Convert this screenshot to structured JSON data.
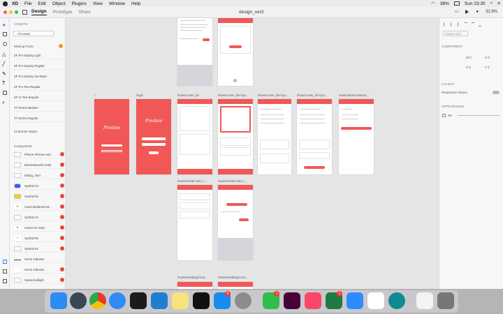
{
  "menubar": {
    "items": [
      "XD",
      "File",
      "Edit",
      "Object",
      "Plugins",
      "View",
      "Window",
      "Help"
    ],
    "battery": "38%",
    "clock": "Sun 23:30"
  },
  "titlebar": {
    "tabs": [
      "Design",
      "Prototype",
      "Share"
    ],
    "doc_title": "design_ver3",
    "zoom": "32.9%"
  },
  "assets": {
    "heading": "ASSETS",
    "filter": "All Assets",
    "missing_fonts_label": "Missing Fonts",
    "fonts": [
      "SF Pro Display Light",
      "SF Pro Display Regular",
      "SF Pro Display Semibold",
      "SF Pro Text Regular",
      "SF UI Text Regular",
      "TT Norms Medium",
      "TT Norms Regular"
    ],
    "character_styles_label": "Character Styles",
    "components_label": "Components",
    "components": [
      "iPhone X/Home Indi...",
      "Bars/Status/On Dark",
      "Dialog_Alert",
      "Symbol 44",
      "Symbol 93",
      "round-airplanemod...",
      "Symbol 44",
      "round-mic-24px",
      "Symbol 60",
      "Symbol 61",
      "Home Indicator",
      "Home Indicator",
      "Status bar/light"
    ]
  },
  "artboards": {
    "labels": [
      "/",
      "/login",
      "/home/<user_id>",
      "/home/<user_id>/<po...",
      "/home/<user_id>/<po...",
      "/home/<user_id>/<po...",
      "/reservation/<reserva...",
      "/mentor/chat/<user_i...",
      "/mentor/chat/<user_i...",
      "/mentor/settings/<me...",
      "/mentor/settings/<me..."
    ],
    "brand": "Presbee"
  },
  "property_inspector": {
    "repeat_grid": "Repeat Grid",
    "component_label": "COMPONENT",
    "layout_label": "LAYOUT",
    "responsive_resize": "Responsive Resize",
    "appearance_label": "APPEARANCE",
    "opacity": "0%",
    "w": "0",
    "h": "0",
    "x": "0",
    "y": "0"
  },
  "dock": {
    "badges": [
      "1",
      "6",
      "1"
    ]
  },
  "colors": {
    "accent": "#f25757",
    "menubar_bg": "#ececec",
    "canvas_bg": "#e5e5e5"
  }
}
